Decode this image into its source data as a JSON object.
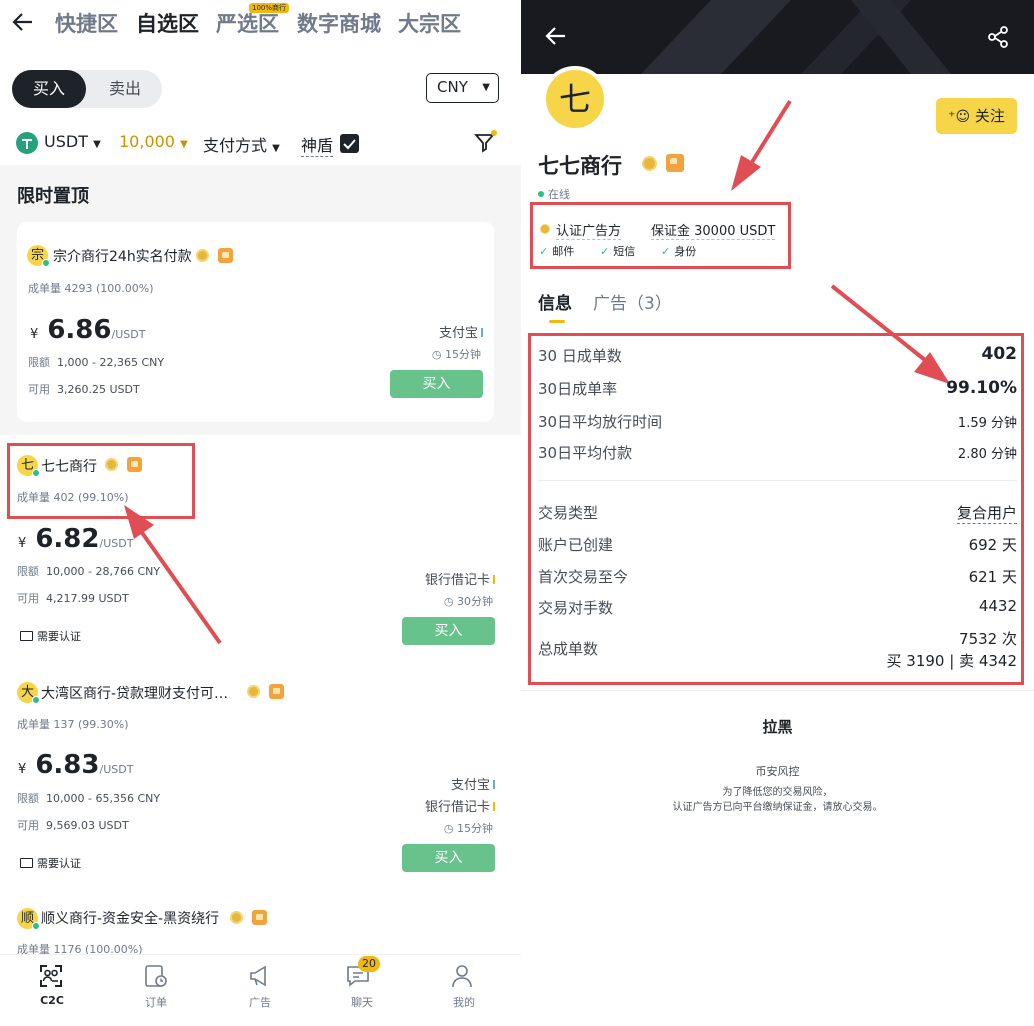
{
  "left": {
    "tabs": [
      "快捷区",
      "自选区",
      "严选区",
      "数字商城",
      "大宗区"
    ],
    "tab_badge": "100%商行",
    "active_tab": "自选区",
    "segment": {
      "buy": "买入",
      "sell": "卖出"
    },
    "currency": "CNY",
    "filters": {
      "asset": "USDT",
      "amount": "10,000",
      "payment": "支付方式",
      "shield": "神盾"
    },
    "section_title": "限时置顶",
    "ads": [
      {
        "avatar": "宗",
        "name": "宗介商行24h实名付款",
        "volume": "成单量",
        "volume_value": "4293 (100.00%)",
        "currency_symbol": "¥",
        "price": "6.86",
        "unit": "/USDT",
        "limit_label": "限额",
        "limit": "1,000 - 22,365 CNY",
        "avail_label": "可用",
        "available": "3,260.25 USDT",
        "payments": [
          "支付宝"
        ],
        "time": "15分钟",
        "button": "买入"
      },
      {
        "avatar": "七",
        "name": "七七商行",
        "volume": "成单量",
        "volume_value": "402 (99.10%)",
        "currency_symbol": "¥",
        "price": "6.82",
        "unit": "/USDT",
        "limit_label": "限额",
        "limit": "10,000 - 28,766 CNY",
        "avail_label": "可用",
        "available": "4,217.99 USDT",
        "payments": [
          "银行借记卡"
        ],
        "time": "30分钟",
        "button": "买入",
        "need": "需要认证"
      },
      {
        "avatar": "大",
        "name": "大湾区商行-贷款理财支付可…",
        "volume": "成单量",
        "volume_value": "137 (99.30%)",
        "currency_symbol": "¥",
        "price": "6.83",
        "unit": "/USDT",
        "limit_label": "限额",
        "limit": "10,000 - 65,356 CNY",
        "avail_label": "可用",
        "available": "9,569.03 USDT",
        "payments": [
          "支付宝",
          "银行借记卡"
        ],
        "time": "15分钟",
        "button": "买入",
        "need": "需要认证"
      },
      {
        "avatar": "顺",
        "name": "顺义商行-资金安全-黑资绕行",
        "volume": "成单量",
        "volume_value": "1176 (100.00%)"
      }
    ],
    "nav": [
      {
        "label": "C2C",
        "icon": "c2c-icon"
      },
      {
        "label": "订单",
        "icon": "order-icon"
      },
      {
        "label": "广告",
        "icon": "megaphone-icon"
      },
      {
        "label": "聊天",
        "icon": "chat-icon"
      },
      {
        "label": "我的",
        "icon": "user-icon"
      }
    ],
    "chat_badge": "20"
  },
  "right": {
    "avatar": "七",
    "follow": "关注",
    "name": "七七商行",
    "status": "在线",
    "verified_ad": "认证广告方",
    "deposit": "保证金 30000 USDT",
    "checks": [
      "邮件",
      "短信",
      "身份"
    ],
    "tabs": {
      "info": "信息",
      "ads": "广告（3）"
    },
    "stats_top": [
      {
        "label": "30 日成单数",
        "value": "402"
      },
      {
        "label": "30日成单率",
        "value": "99.10%"
      },
      {
        "label": "30日平均放行时间",
        "value": "1.59 分钟"
      },
      {
        "label": "30日平均付款",
        "value": "2.80 分钟"
      }
    ],
    "stats_bottom": [
      {
        "label": "交易类型",
        "value": "复合用户"
      },
      {
        "label": "账户已创建",
        "value": "692 天"
      },
      {
        "label": "首次交易至今",
        "value": "621 天"
      },
      {
        "label": "交易对手数",
        "value": "4432"
      }
    ],
    "total": {
      "label": "总成单数",
      "value": "7532 次",
      "detail": "买 3190 | 卖 4342"
    },
    "block": "拉黑",
    "risk_title": "币安风控",
    "risk_line1": "为了降低您的交易风险，",
    "risk_line2": "认证广告方已向平台缴纳保证金，请放心交易。"
  },
  "colors": {
    "accent": "#f0b90b",
    "buy_green": "#67c38b",
    "annotation_red": "#e04d52",
    "dark": "#181a20"
  }
}
